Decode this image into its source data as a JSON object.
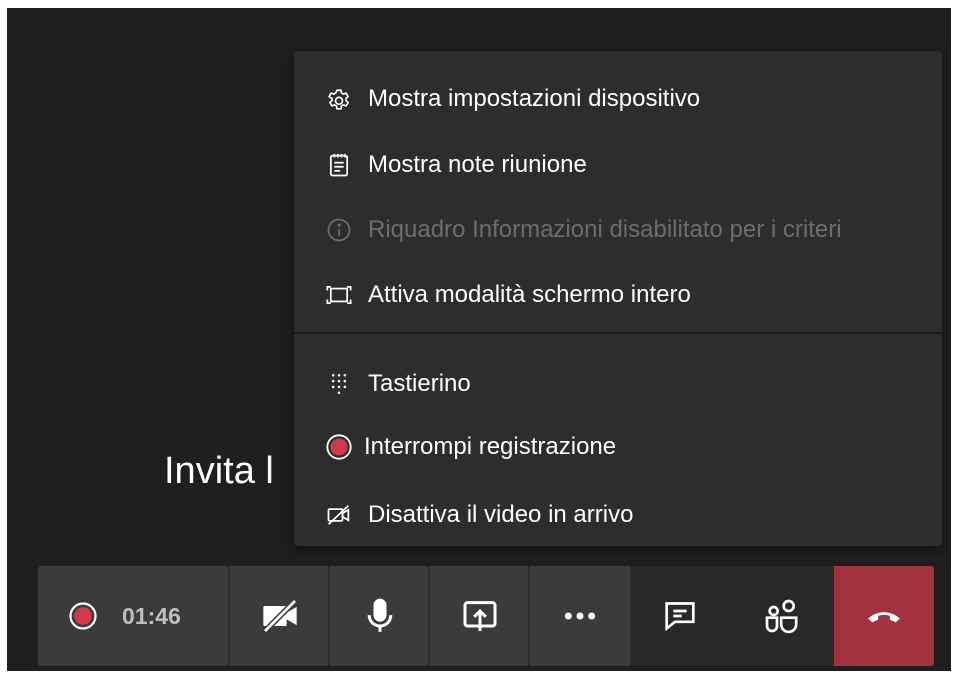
{
  "background": {
    "invite_text": "Invita l"
  },
  "menu": {
    "items": [
      {
        "label": "Mostra impostazioni dispositivo",
        "icon": "gear-icon",
        "enabled": true
      },
      {
        "label": "Mostra note riunione",
        "icon": "notes-icon",
        "enabled": true
      },
      {
        "label": "Riquadro Informazioni disabilitato per i criteri",
        "icon": "info-icon",
        "enabled": false
      },
      {
        "label": "Attiva modalità schermo intero",
        "icon": "fullscreen-icon",
        "enabled": true
      },
      {
        "label": "Tastierino",
        "icon": "dialpad-icon",
        "enabled": true
      },
      {
        "label": "Interrompi registrazione",
        "icon": "record-icon",
        "enabled": true
      },
      {
        "label": "Disattiva il video in arrivo",
        "icon": "video-off-icon",
        "enabled": true
      }
    ]
  },
  "controls": {
    "timer": "01:46",
    "buttons": [
      "record-indicator-icon",
      "camera-off-icon",
      "microphone-icon",
      "share-screen-icon",
      "more-options-icon",
      "chat-icon",
      "participants-icon",
      "hang-up-icon"
    ]
  },
  "colors": {
    "record": "#d23a4a",
    "hangup": "#a4313f",
    "menu_bg": "#2d2d2d",
    "bar_bg": "#3b3b3b",
    "stage_bg": "#1f1f1f"
  }
}
